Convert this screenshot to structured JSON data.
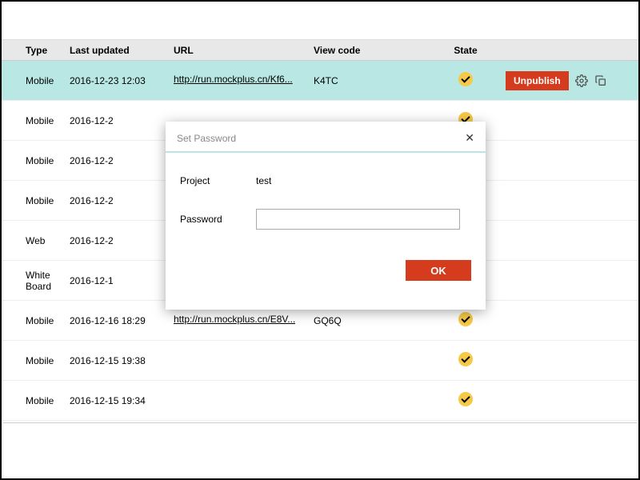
{
  "headers": {
    "type": "Type",
    "lastUpdated": "Last updated",
    "url": "URL",
    "viewCode": "View code",
    "state": "State"
  },
  "unpublishLabel": "Unpublish",
  "rows": [
    {
      "type": "Mobile",
      "updated": "2016-12-23 12:03",
      "url": "http://run.mockplus.cn/Kf6...",
      "viewCode": "K4TC",
      "highlighted": true,
      "showActions": true
    },
    {
      "type": "Mobile",
      "updated": "2016-12-2",
      "url": "",
      "viewCode": ""
    },
    {
      "type": "Mobile",
      "updated": "2016-12-2",
      "url": "",
      "viewCode": ""
    },
    {
      "type": "Mobile",
      "updated": "2016-12-2",
      "url": "",
      "viewCode": ""
    },
    {
      "type": "Web",
      "updated": "2016-12-2",
      "url": "",
      "viewCode": ""
    },
    {
      "type": "White Board",
      "updated": "2016-12-1",
      "url": "",
      "viewCode": ""
    },
    {
      "type": "Mobile",
      "updated": "2016-12-16 18:29",
      "url": "http://run.mockplus.cn/E8V...",
      "viewCode": "GQ6Q"
    },
    {
      "type": "Mobile",
      "updated": "2016-12-15 19:38",
      "url": "",
      "viewCode": ""
    },
    {
      "type": "Mobile",
      "updated": "2016-12-15 19:34",
      "url": "",
      "viewCode": ""
    }
  ],
  "modal": {
    "title": "Set Password",
    "projectLabel": "Project",
    "projectValue": "test",
    "passwordLabel": "Password",
    "okLabel": "OK"
  }
}
